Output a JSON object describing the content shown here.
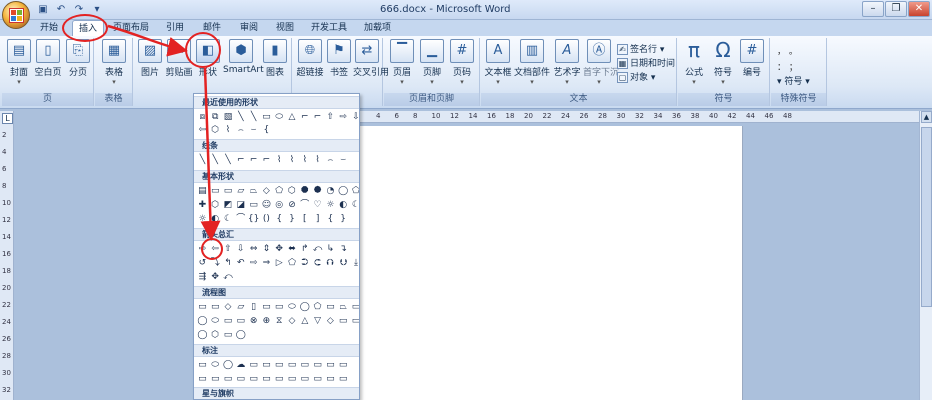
{
  "window": {
    "title": "666.docx - Microsoft Word"
  },
  "qat": [
    "save-icon",
    "undo-icon",
    "redo-icon",
    "customize-icon"
  ],
  "tabs": [
    "开始",
    "插入",
    "页面布局",
    "引用",
    "邮件",
    "审阅",
    "视图",
    "开发工具",
    "加载项"
  ],
  "groups": {
    "pages": {
      "label": "页",
      "buttons": [
        "封面",
        "空白页",
        "分页"
      ]
    },
    "tables": {
      "label": "表格",
      "buttons": [
        "表格"
      ]
    },
    "illustrations": {
      "buttons": [
        "图片",
        "剪贴画",
        "形状",
        "SmartArt",
        "图表"
      ]
    },
    "links": {
      "buttons": [
        "超链接",
        "书签",
        "交叉引用"
      ]
    },
    "header_footer": {
      "label": "页眉和页脚",
      "buttons": [
        "页眉",
        "页脚",
        "页码"
      ]
    },
    "text": {
      "label": "文本",
      "buttons": [
        "文本框",
        "文档部件",
        "艺术字",
        "首字下沉"
      ],
      "small": [
        "签名行",
        "日期和时间",
        "对象"
      ]
    },
    "symbols": {
      "label": "符号",
      "buttons": [
        "公式",
        "符号",
        "编号"
      ]
    },
    "special": {
      "label": "特殊符号",
      "small": [
        "符号"
      ]
    }
  },
  "ruler": [
    "4",
    "6",
    "8",
    "10",
    "12",
    "14",
    "16",
    "18",
    "20",
    "22",
    "24",
    "26",
    "28",
    "30",
    "32",
    "34",
    "36",
    "38",
    "40",
    "42",
    "44",
    "46",
    "48"
  ],
  "vruler": [
    "2",
    "4",
    "6",
    "8",
    "10",
    "12",
    "14",
    "16",
    "18",
    "20",
    "22",
    "24",
    "26",
    "28",
    "30",
    "32"
  ],
  "shapes_menu": {
    "sections": [
      "最近使用的形状",
      "线条",
      "基本形状",
      "箭头总汇",
      "流程图",
      "标注",
      "星与旗帜"
    ],
    "recent": [
      "⧈",
      "⧉",
      "▧",
      "╲",
      "╲",
      "▭",
      "⬭",
      "△",
      "⌐",
      "⌐",
      "⇧",
      "⇨",
      "⇩"
    ],
    "recent2": [
      "⇦",
      "⬡",
      "⌇",
      "⌢",
      "⌣",
      "{"
    ],
    "lines": [
      "╲",
      "╲",
      "╲",
      "⌐",
      "⌐",
      "⌐",
      "⌇",
      "⌇",
      "⌇",
      "⌇",
      "⌢",
      "⌣"
    ],
    "basic1": [
      "▤",
      "▭",
      "▭",
      "▱",
      "⏢",
      "◇",
      "⬠",
      "⬡",
      "⯃",
      "⯄",
      "◔",
      "◯",
      "⬠"
    ],
    "basic2": [
      "✚",
      "⬡",
      "◩",
      "◪",
      "▭",
      "☺",
      "◎",
      "⊘",
      "⌒",
      "♡",
      "☼",
      "◐",
      "☾"
    ],
    "basic3": [
      "☼",
      "◐",
      "☾",
      "⌒",
      "{}",
      "()",
      "{",
      "}",
      "[",
      "]",
      "{",
      "}"
    ],
    "arrows1": [
      "⇨",
      "⇦",
      "⇧",
      "⇩",
      "⇔",
      "⇕",
      "✥",
      "⬌",
      "↱",
      "⤺",
      "↳",
      "↴"
    ],
    "arrows2": [
      "↺",
      "⤵",
      "↰",
      "↶",
      "⇨",
      "⇒",
      "▷",
      "⬠",
      "⮊",
      "⮈",
      "⮉",
      "⮋",
      "⤓"
    ],
    "arrows3": [
      "⇶",
      "✥",
      "⤺"
    ],
    "flow1": [
      "▭",
      "▭",
      "◇",
      "▱",
      "▯",
      "▭",
      "▭",
      "⬭",
      "◯",
      "⬠",
      "▭",
      "⏢",
      "▭"
    ],
    "flow2": [
      "◯",
      "⬭",
      "▭",
      "▭",
      "⊗",
      "⊕",
      "⧖",
      "◇",
      "△",
      "▽",
      "◇",
      "▭",
      "▭"
    ],
    "flow3": [
      "◯",
      "⬡",
      "▭",
      "◯"
    ],
    "callout1": [
      "▭",
      "⬭",
      "◯",
      "☁",
      "▭",
      "▭",
      "▭",
      "▭",
      "▭",
      "▭",
      "▭",
      "▭"
    ],
    "callout2": [
      "▭",
      "▭",
      "▭",
      "▭",
      "▭",
      "▭",
      "▭",
      "▭",
      "▭",
      "▭",
      "▭",
      "▭"
    ]
  }
}
